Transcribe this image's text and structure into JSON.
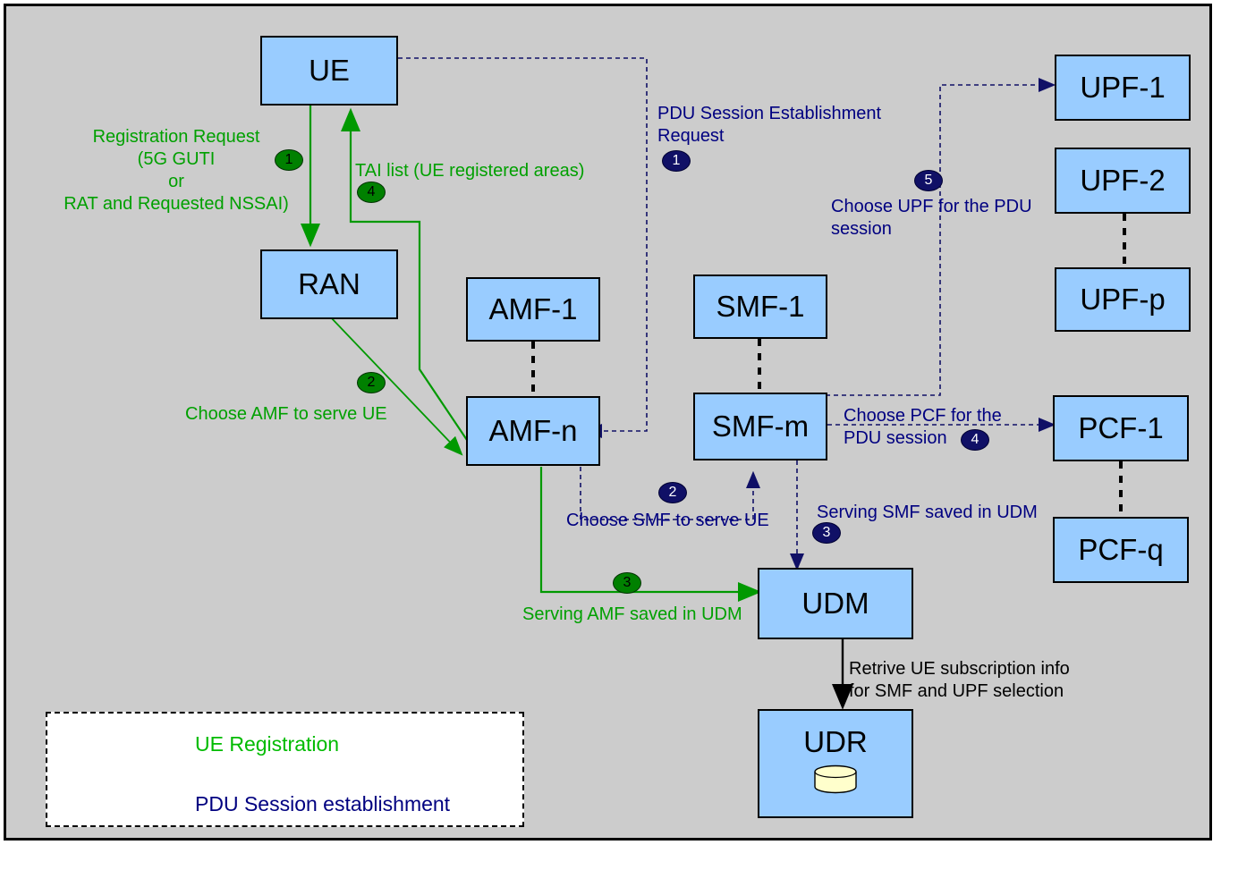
{
  "diagram": {
    "title_present": false,
    "background_color": "#cccccc",
    "node_fill": "#99ccff",
    "registration_color": "#00a000",
    "pdu_color": "#000080"
  },
  "nodes": [
    {
      "id": "ue",
      "label": "UE"
    },
    {
      "id": "ran",
      "label": "RAN"
    },
    {
      "id": "amf1",
      "label": "AMF-1"
    },
    {
      "id": "amfn",
      "label": "AMF-n"
    },
    {
      "id": "smf1",
      "label": "SMF-1"
    },
    {
      "id": "smfm",
      "label": "SMF-m"
    },
    {
      "id": "upf1",
      "label": "UPF-1"
    },
    {
      "id": "upf2",
      "label": "UPF-2"
    },
    {
      "id": "upfp",
      "label": "UPF-p"
    },
    {
      "id": "pcf1",
      "label": "PCF-1"
    },
    {
      "id": "pcfq",
      "label": "PCF-q"
    },
    {
      "id": "udm",
      "label": "UDM"
    },
    {
      "id": "udr",
      "label": "UDR"
    }
  ],
  "annotations": {
    "registration_request": "Registration Request\n(5G GUTI\nor\nRAT and Requested NSSAI)",
    "tai_list": "TAI list (UE registered areas)",
    "choose_amf": "Choose AMF to serve UE",
    "serving_amf_saved": "Serving AMF saved in UDM",
    "pdu_session_request": "PDU Session Establishment\nRequest",
    "choose_smf": "Choose SMF to serve UE",
    "serving_smf_saved": "Serving SMF saved in UDM",
    "choose_pcf": "Choose PCF for the\nPDU session",
    "choose_upf": "Choose UPF for the PDU\nsession",
    "retrieve_subscription": "Retrive UE subscription info\nfor SMF and UPF selection"
  },
  "step_badges": {
    "reg_1": "1",
    "reg_2": "2",
    "reg_3": "3",
    "reg_4": "4",
    "pdu_1": "1",
    "pdu_2": "2",
    "pdu_3": "3",
    "pdu_4": "4",
    "pdu_5": "5"
  },
  "legend": {
    "registration_label": "UE Registration",
    "pdu_label": "PDU Session establishment"
  }
}
